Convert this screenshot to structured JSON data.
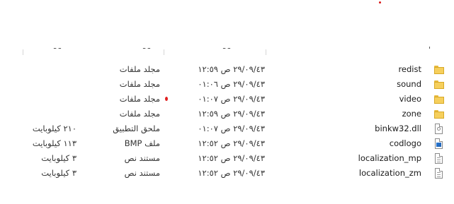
{
  "header": {
    "name_cut": "ا",
    "date_cut": "ـ ـ",
    "type_cut": "ـ ـ",
    "size_cut": "ـ ـ"
  },
  "rows": [
    {
      "name": "redist",
      "date": "٢٩/٠٩/٤٣ ص ١٢:٥٩",
      "type": "مجلد ملفات",
      "size": "",
      "icon": "folder-icon"
    },
    {
      "name": "sound",
      "date": "٢٩/٠٩/٤٣ ص ٠١:٠٦",
      "type": "مجلد ملفات",
      "size": "",
      "icon": "folder-icon"
    },
    {
      "name": "video",
      "date": "٢٩/٠٩/٤٣ ص ٠١:٠٧",
      "type": "مجلد ملفات",
      "size": "",
      "icon": "folder-icon"
    },
    {
      "name": "zone",
      "date": "٢٩/٠٩/٤٣ ص ١٢:٥٩",
      "type": "مجلد ملفات",
      "size": "",
      "icon": "folder-icon"
    },
    {
      "name": "binkw32.dll",
      "date": "٢٩/٠٩/٤٣ ص ٠١:٠٧",
      "type": "ملحق التطبيق",
      "size": "٢١٠ كيلوبايت",
      "icon": "dll-file-icon"
    },
    {
      "name": "codlogo",
      "date": "٢٩/٠٩/٤٣ ص ١٢:٥٢",
      "type": "ملف BMP",
      "size": "١١٣ كيلوبايت",
      "icon": "bitmap-file-icon"
    },
    {
      "name": "localization_mp",
      "date": "٢٩/٠٩/٤٣ ص ١٢:٥٢",
      "type": "مستند نص",
      "size": "٣ كيلوبايت",
      "icon": "text-file-icon"
    },
    {
      "name": "localization_zm",
      "date": "٢٩/٠٩/٤٣ ص ١٢:٥٢",
      "type": "مستند نص",
      "size": "٣ كيلوبايت",
      "icon": "text-file-icon"
    }
  ],
  "colors": {
    "folder": "#f6cf5c",
    "accent_dot": "#d91a1a"
  }
}
